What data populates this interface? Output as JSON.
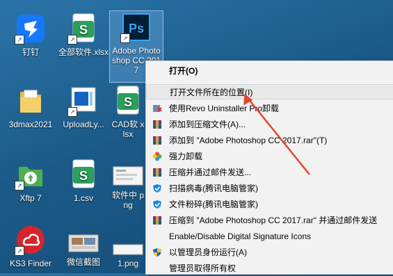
{
  "desktop": {
    "icons": [
      {
        "label": "钉钉"
      },
      {
        "label": "全部软件.xlsx"
      },
      {
        "label": "Adobe Photoshop CC 2017"
      },
      {
        "label": "3dmax2021"
      },
      {
        "label": "UploadLy..."
      },
      {
        "label": "CAD软 xlsx"
      },
      {
        "label": "Xftp 7"
      },
      {
        "label": "1.csv"
      },
      {
        "label": "软件中 png"
      },
      {
        "label": "KS3 Finder"
      },
      {
        "label": "微信截图"
      },
      {
        "label": "1.png"
      }
    ]
  },
  "context_menu": {
    "items": [
      {
        "label": "打开(O)"
      },
      {
        "label": "打开文件所在的位置(I)"
      },
      {
        "label": "使用Revo Uninstaller Pro卸载"
      },
      {
        "label": "添加到压缩文件(A)..."
      },
      {
        "label": "添加到 \"Adobe Photoshop CC 2017.rar\"(T)"
      },
      {
        "label": "强力卸载"
      },
      {
        "label": "压缩并通过邮件发送..."
      },
      {
        "label": "扫描病毒(腾讯电脑管家)"
      },
      {
        "label": "文件粉碎(腾讯电脑管家)"
      },
      {
        "label": "压缩到 \"Adobe Photoshop CC 2017.rar\" 并通过邮件发送"
      },
      {
        "label": "Enable/Disable Digital Signature Icons"
      },
      {
        "label": "以管理员身份运行(A)"
      },
      {
        "label": "管理员取得所有权"
      }
    ]
  },
  "colors": {
    "desktop_bg": "#1d5e8e",
    "arrow": "#e04632",
    "ps_bg": "#001e36",
    "ps_text": "#31a8ff",
    "wps_green": "#2aa05a"
  },
  "icons_meta": {
    "dingtalk": "dingtalk-icon",
    "wps": "wps-spreadsheet-icon",
    "photoshop": "photoshop-icon",
    "folder": "folder-icon",
    "revo": "revo-uninstaller-icon",
    "winrar": "winrar-icon",
    "shield": "tencent-shield-icon",
    "uac": "uac-shield-icon"
  }
}
